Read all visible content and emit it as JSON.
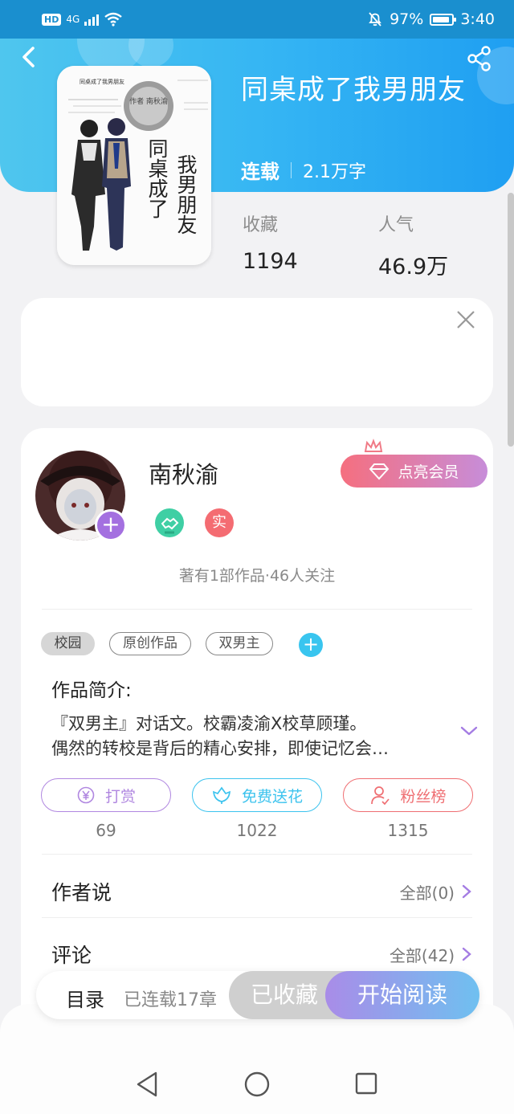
{
  "status_bar": {
    "network": "4G",
    "hd": "HD",
    "battery": "97%",
    "time": "3:40"
  },
  "book": {
    "title": "同桌成了我男朋友",
    "status": "连载",
    "word_count": "2.1万字",
    "favorites_label": "收藏",
    "favorites": "1194",
    "popularity_label": "人气",
    "popularity": "46.9万",
    "cover": {
      "title_line1": "同桌成了",
      "title_line2": "我男朋友",
      "author_stamp": "作者 南秋渝",
      "small_title": "同桌成了我男朋友"
    }
  },
  "author": {
    "name": "南秋渝",
    "real_badge": "实",
    "works": "著有1部作品·46人关注",
    "vip_label": "点亮会员"
  },
  "tags": [
    "校园",
    "原创作品",
    "双男主"
  ],
  "intro": {
    "heading": "作品简介:",
    "line1": "『双男主』对话文。校霸凌渝X校草顾瑾。",
    "line2": "偶然的转校是背后的精心安排，即使记忆会…"
  },
  "actions": [
    {
      "label": "打赏",
      "count": "69",
      "color": "#b087e0",
      "icon": "yen-icon"
    },
    {
      "label": "免费送花",
      "count": "1022",
      "color": "#3cc3ee",
      "icon": "flower-icon"
    },
    {
      "label": "粉丝榜",
      "count": "1315",
      "color": "#ef6e72",
      "icon": "fan-icon"
    }
  ],
  "rows": {
    "author_says": {
      "title": "作者说",
      "link": "全部(0)"
    },
    "comments": {
      "title": "评论",
      "link": "全部(42)"
    }
  },
  "bottom_bar": {
    "toc": "目录",
    "chapters": "已连载17章",
    "collected": "已收藏",
    "read": "开始阅读"
  },
  "colors": {
    "header_blue": "#36b6f3",
    "accent_purple": "#a47ce3"
  }
}
